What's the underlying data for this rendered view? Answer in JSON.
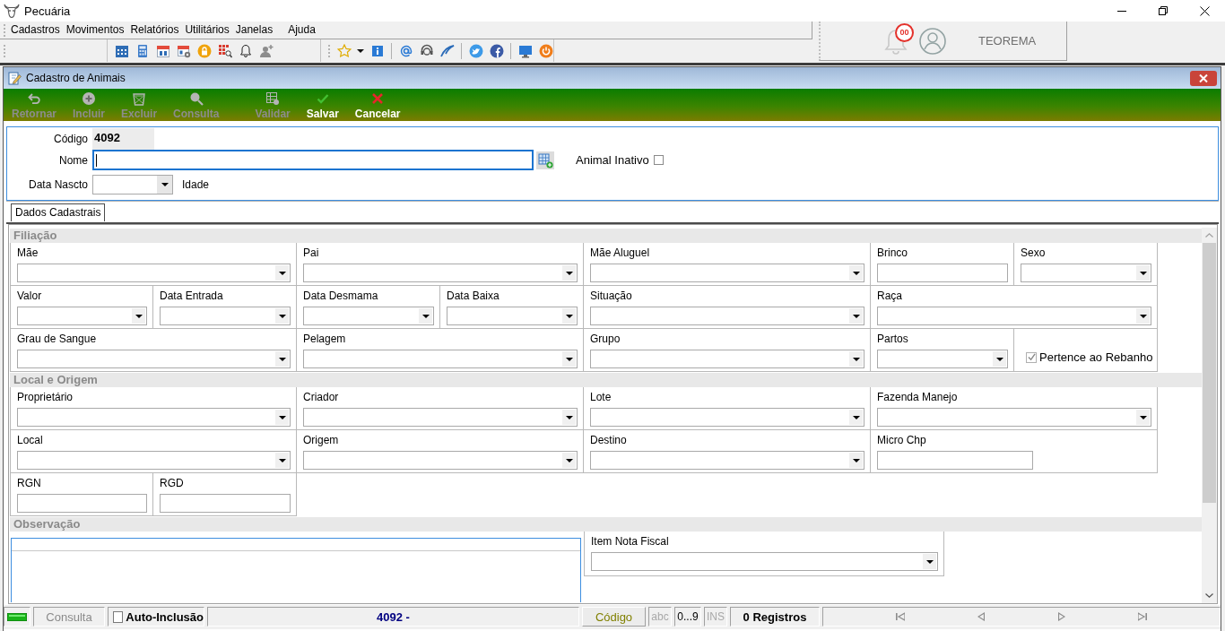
{
  "window": {
    "title": "Pecuária"
  },
  "menu": [
    "Cadastros",
    "Movimentos",
    "Relatórios",
    "Utilitários",
    "Janelas",
    "Ajuda"
  ],
  "user_panel": {
    "notification_count": "00",
    "company": "TEOREMA"
  },
  "child_window": {
    "title": "Cadastro de Animais"
  },
  "toolbar": [
    {
      "label": "Retornar",
      "disabled": true
    },
    {
      "label": "Incluir",
      "disabled": true
    },
    {
      "label": "Excluir",
      "disabled": true
    },
    {
      "label": "Consulta",
      "disabled": true
    },
    {
      "label": "Validar",
      "disabled": true
    },
    {
      "label": "Salvar",
      "disabled": false
    },
    {
      "label": "Cancelar",
      "disabled": false
    }
  ],
  "header": {
    "codigo": {
      "label": "Código",
      "value": "4092"
    },
    "nome": {
      "label": "Nome",
      "focused": true
    },
    "animal_inativo": {
      "label": "Animal Inativo",
      "checked": false
    },
    "data_nascto": {
      "label": "Data Nascto"
    },
    "idade": {
      "label": "Idade"
    }
  },
  "tabs": [
    {
      "label": "Dados Cadastrais",
      "selected": true
    }
  ],
  "sections": [
    {
      "title": "Filiação",
      "fields": [
        {
          "label": "Mãe",
          "kind": "combo"
        },
        {
          "label": "Pai",
          "kind": "combo"
        },
        {
          "label": "Mãe Aluguel",
          "kind": "combo"
        },
        {
          "label": "Brinco",
          "kind": "text"
        },
        {
          "label": "Sexo",
          "kind": "combo"
        },
        {
          "label": "Valor",
          "kind": "combo"
        },
        {
          "label": "Data Entrada",
          "kind": "combo"
        },
        {
          "label": "Data Desmama",
          "kind": "combo"
        },
        {
          "label": "Data Baixa",
          "kind": "combo"
        },
        {
          "label": "Situação",
          "kind": "combo"
        },
        {
          "label": "Raça",
          "kind": "combo"
        },
        {
          "label": "Grau de Sangue",
          "kind": "combo"
        },
        {
          "label": "Pelagem",
          "kind": "combo"
        },
        {
          "label": "Grupo",
          "kind": "combo"
        },
        {
          "label": "Partos",
          "kind": "combo"
        },
        {
          "label": "Pertence ao Rebanho",
          "kind": "check",
          "checked": true
        }
      ]
    },
    {
      "title": "Local e Origem",
      "fields": [
        {
          "label": "Proprietário",
          "kind": "combo"
        },
        {
          "label": "Criador",
          "kind": "combo"
        },
        {
          "label": "Lote",
          "kind": "combo"
        },
        {
          "label": "Fazenda Manejo",
          "kind": "combo"
        },
        {
          "label": "Local",
          "kind": "combo"
        },
        {
          "label": "Origem",
          "kind": "combo"
        },
        {
          "label": "Destino",
          "kind": "combo"
        },
        {
          "label": "Micro Chp",
          "kind": "text"
        },
        {
          "label": "RGN",
          "kind": "text"
        },
        {
          "label": "RGD",
          "kind": "text"
        }
      ]
    },
    {
      "title": "Observação",
      "fields": [
        {
          "kind": "memo"
        },
        {
          "label": "Item Nota Fiscal",
          "kind": "combo"
        }
      ]
    }
  ],
  "status_bar": {
    "mode": "Consulta",
    "auto_inclusao": {
      "label": "Auto-Inclusão",
      "checked": false
    },
    "record": "4092 -",
    "sort_field": "Código",
    "indicators": [
      {
        "label": "abc",
        "on": false
      },
      {
        "label": "0...9",
        "on": true
      },
      {
        "label": "INS",
        "on": false
      }
    ],
    "count": "0 Registros"
  }
}
